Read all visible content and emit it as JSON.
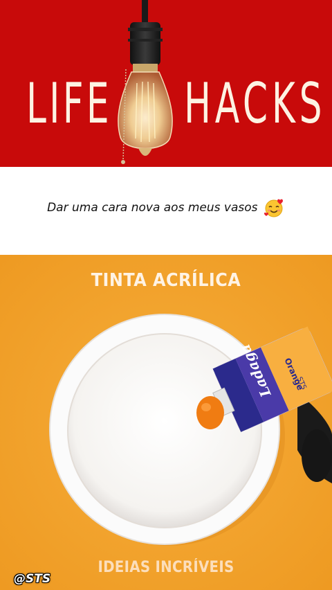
{
  "header": {
    "title_left": "LIFE",
    "title_right": "HACKS",
    "background_color": "#c80a0a",
    "text_color": "#fdf3e3"
  },
  "caption": {
    "text": "Dar uma cara nova aos meus vasos",
    "emoji_icon": "smiling-face-with-hearts-icon"
  },
  "video": {
    "top_text": "TINTA ACRÍLICA",
    "bottom_text": "IDEIAS INCRÍVEIS",
    "background_color": "#f3a42f",
    "tube": {
      "brand": "Ladaga",
      "color_name": "Orange",
      "code": "STS"
    }
  },
  "watermark": "@STS"
}
